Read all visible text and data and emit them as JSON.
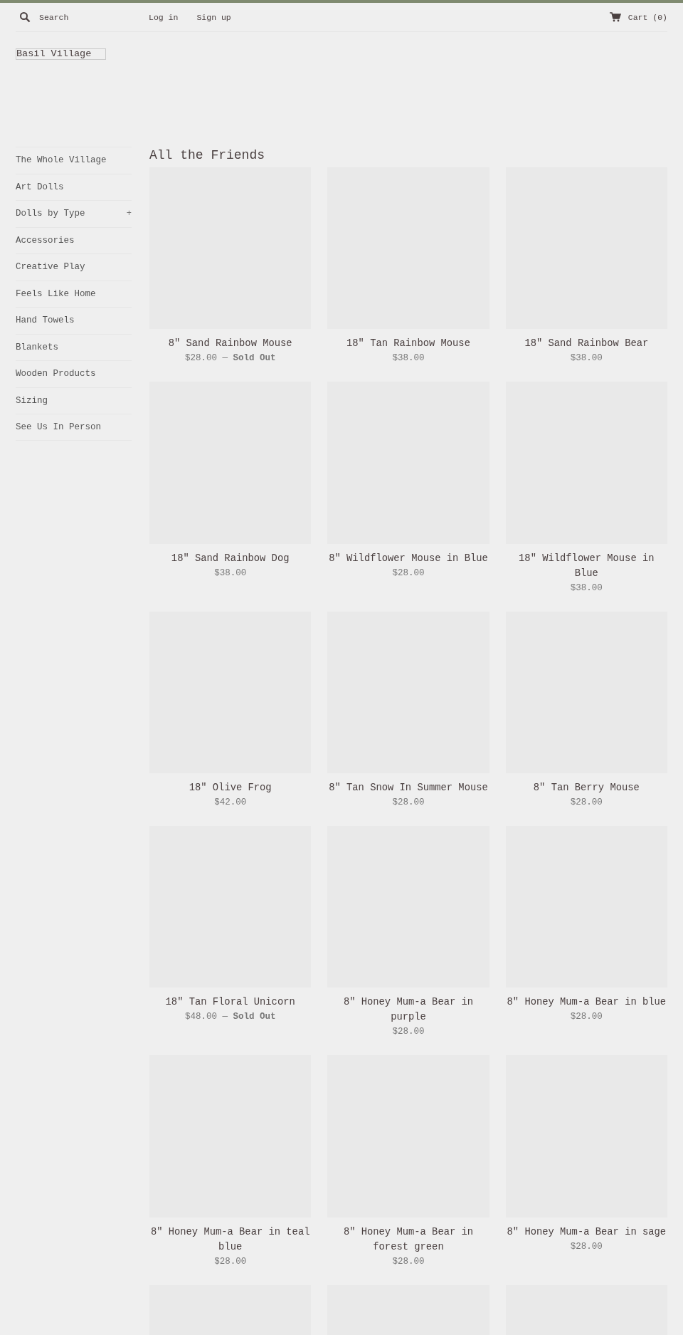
{
  "header": {
    "search": {
      "placeholder": "Search"
    },
    "links": [
      "Log in",
      "Sign up"
    ],
    "cart": "Cart (0)"
  },
  "logo": "Basil Village",
  "sidebar": {
    "items": [
      {
        "label": "The Whole Village"
      },
      {
        "label": "Art Dolls"
      },
      {
        "label": "Dolls by Type",
        "toggle": "+"
      },
      {
        "label": "Accessories"
      },
      {
        "label": "Creative Play"
      },
      {
        "label": "Feels Like Home"
      },
      {
        "label": "Hand Towels"
      },
      {
        "label": "Blankets"
      },
      {
        "label": "Wooden Products"
      },
      {
        "label": "Sizing"
      },
      {
        "label": "See Us In Person"
      }
    ]
  },
  "collection": {
    "title": "All the Friends",
    "products": [
      {
        "kind": "picture",
        "title": "8\" Sand Rainbow Mouse",
        "price": "$28.00 — **Sold Out**"
      },
      {
        "kind": "picture",
        "title": "18\" Tan Rainbow Mouse",
        "price": "$38.00"
      },
      {
        "kind": "picture",
        "title": "18\" Sand Rainbow Bear",
        "price": "$38.00"
      },
      {
        "kind": "picture",
        "title": "18\" Sand Rainbow Dog",
        "price": "$38.00"
      },
      {
        "kind": "picture",
        "title": "8\" Wildflower Mouse in Blue",
        "price": "$28.00"
      },
      {
        "kind": "picture",
        "title": "18\" Wildflower Mouse in Blue",
        "price": "$38.00"
      },
      {
        "kind": "picture",
        "title": "18\" Olive Frog",
        "price": "$42.00"
      },
      {
        "kind": "picture",
        "title": "8\" Tan Snow In Summer Mouse",
        "price": "$28.00"
      },
      {
        "kind": "picture",
        "title": "8\" Tan Berry Mouse",
        "price": "$28.00"
      },
      {
        "kind": "picture",
        "title": "18\" Tan Floral Unicorn",
        "price": "$48.00 — **Sold Out**"
      },
      {
        "kind": "picture",
        "title": "8\" Honey Mum-a Bear in purple",
        "price": "$28.00"
      },
      {
        "kind": "picture",
        "title": "8\" Honey Mum-a Bear in blue",
        "price": "$28.00"
      },
      {
        "kind": "picture",
        "title": "8\" Honey Mum-a Bear in teal blue",
        "price": "$28.00"
      },
      {
        "kind": "picture",
        "title": "8\" Honey Mum-a Bear in forest green",
        "price": "$28.00"
      },
      {
        "kind": "picture",
        "title": "8\" Honey Mum-a Bear in sage",
        "price": "$28.00"
      },
      {
        "kind": "picture"
      },
      {
        "kind": "picture"
      },
      {
        "kind": "picture"
      }
    ]
  }
}
